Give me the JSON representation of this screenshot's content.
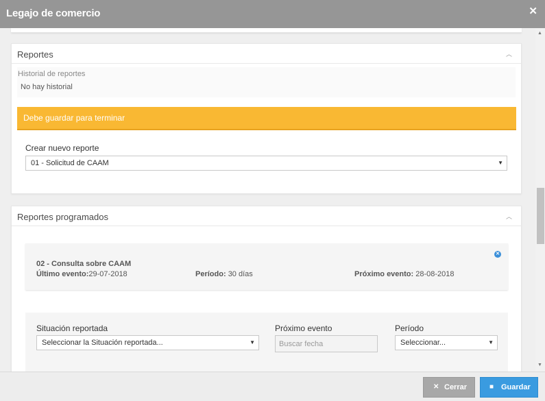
{
  "window": {
    "title": "Legajo de comercio",
    "close_glyph": "✕"
  },
  "reportes": {
    "title": "Reportes",
    "history_label": "Historial de reportes",
    "history_value": "No hay historial",
    "warning": "Debe guardar para terminar",
    "create_label": "Crear nuevo reporte",
    "create_selected": "01 - Solicitud de CAAM"
  },
  "programados": {
    "title": "Reportes programados",
    "item": {
      "title": "02 - Consulta sobre CAAM",
      "ultimo_label": "Último evento:",
      "ultimo_value": "29-07-2018",
      "periodo_label": "Período:",
      "periodo_value": "30 días",
      "proximo_label": "Próximo evento:",
      "proximo_value": "28-08-2018"
    },
    "form": {
      "situacion_label": "Situación reportada",
      "situacion_selected": "Seleccionar la Situación reportada...",
      "proximo_label": "Próximo evento",
      "proximo_placeholder": "Buscar fecha",
      "periodo_label": "Período",
      "periodo_selected": "Seleccionar..."
    }
  },
  "footer": {
    "cerrar": "Cerrar",
    "guardar": "Guardar"
  },
  "icons": {
    "collapse": "chevron-up-icon",
    "caret": "caret-down-icon",
    "remove": "remove-circle-icon",
    "close": "close-icon",
    "save": "floppy-disk-icon"
  },
  "colors": {
    "warning": "#f9b833",
    "primary": "#3a9be0",
    "secondary": "#a8a8a8",
    "titlebar": "#969696"
  }
}
